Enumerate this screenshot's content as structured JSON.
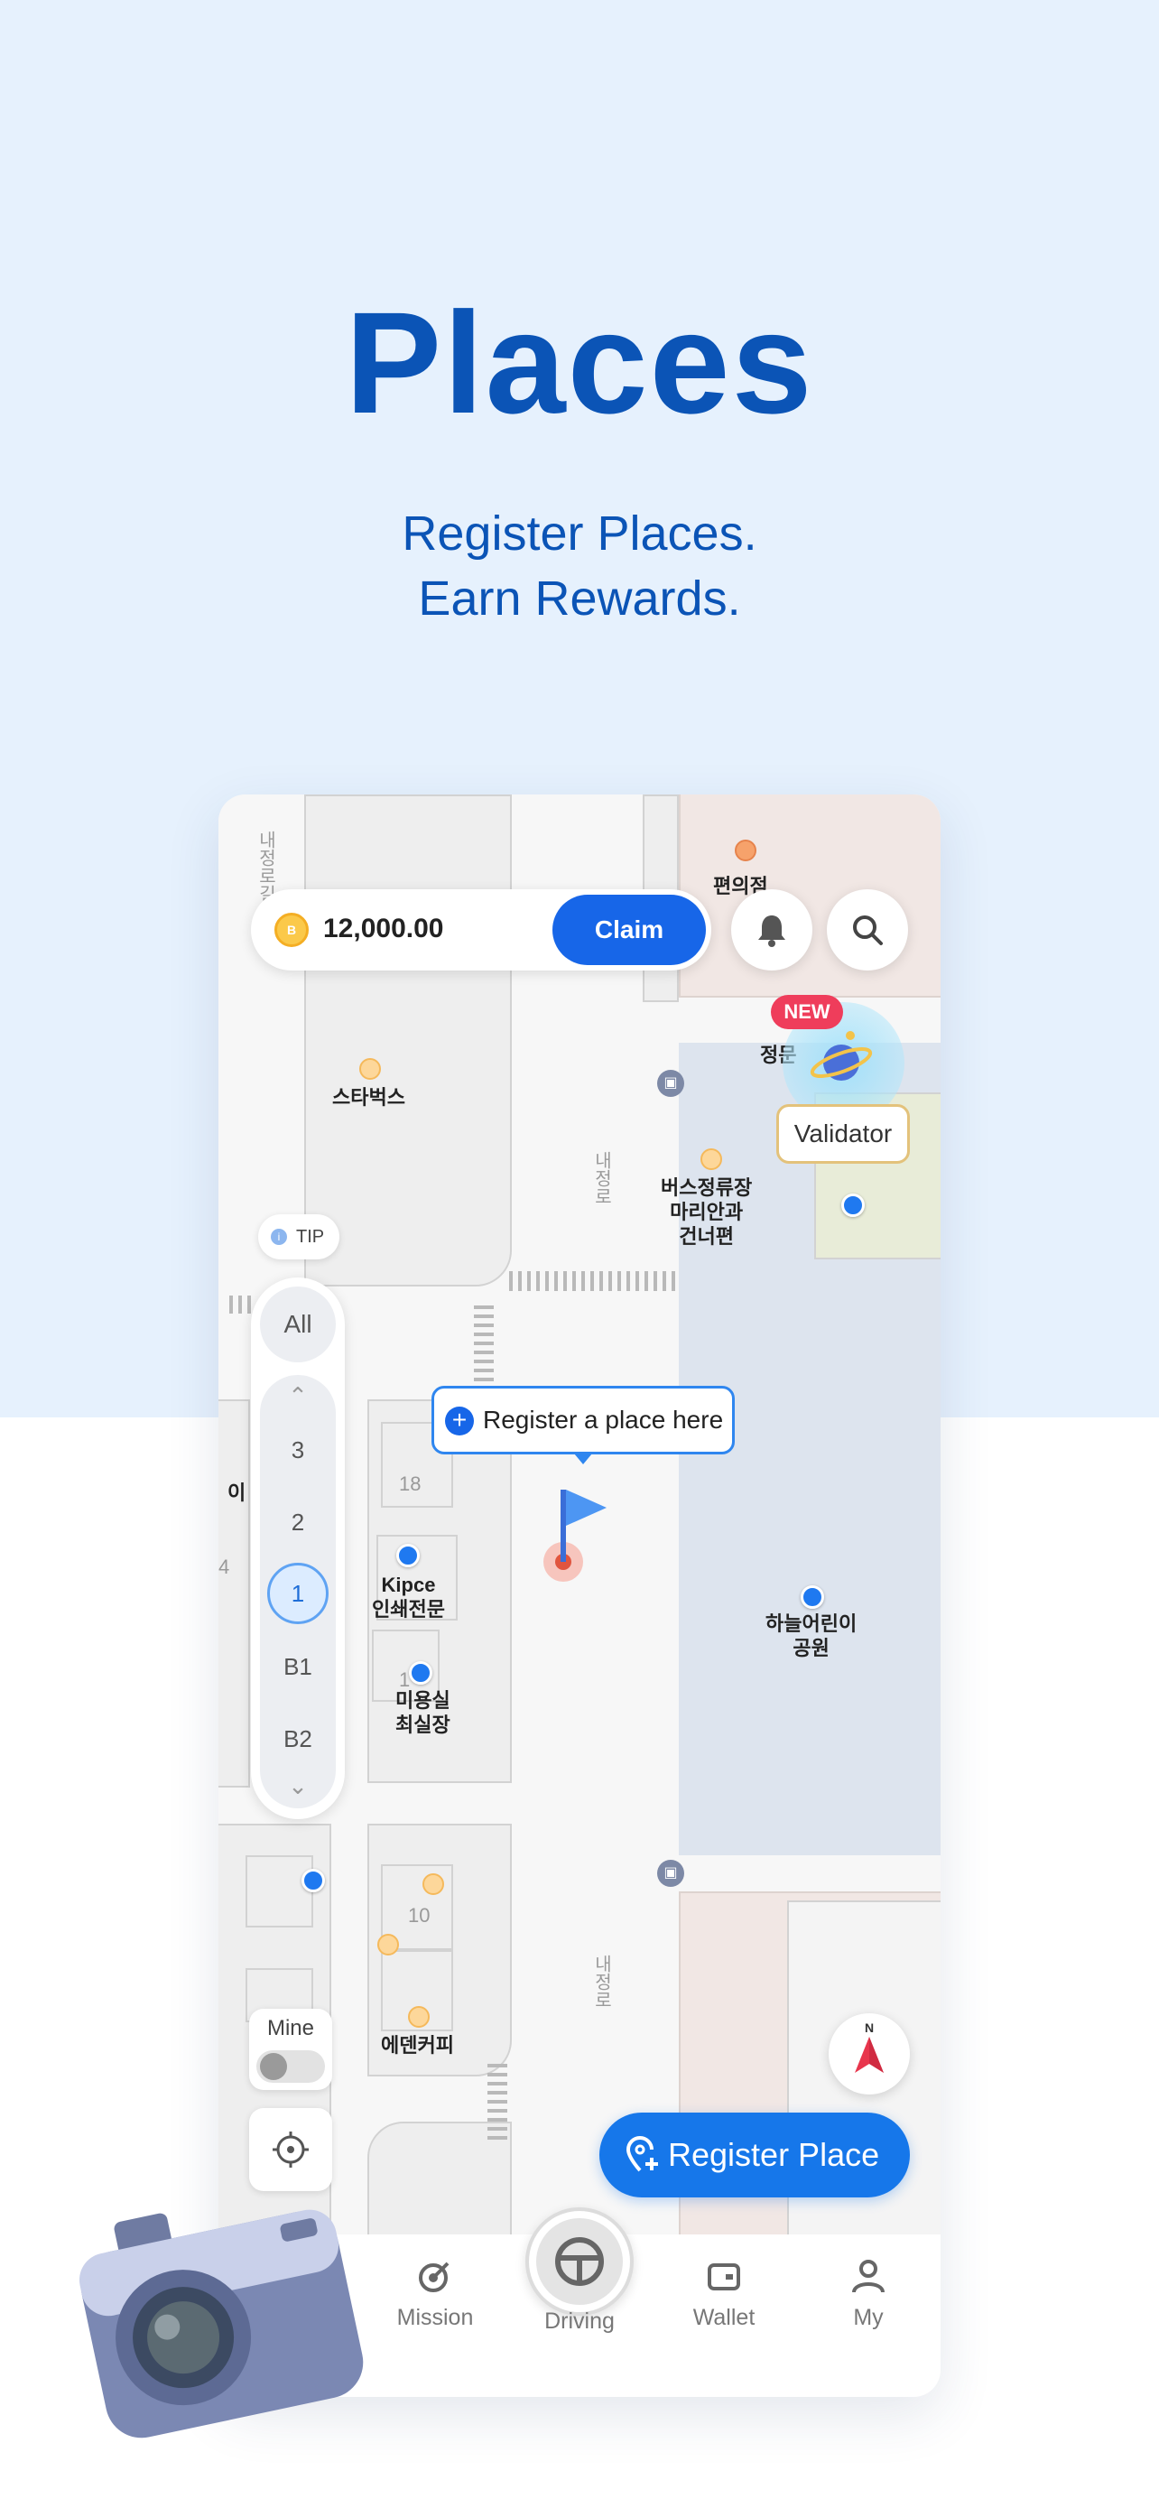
{
  "hero": {
    "title": "Places",
    "subtitle_line1": "Register Places.",
    "subtitle_line2": "Earn Rewards."
  },
  "coins": {
    "icon_letter": "B",
    "value": "12,000.00",
    "claim_label": "Claim"
  },
  "tip": {
    "label": "TIP"
  },
  "floors": {
    "all_label": "All",
    "items": [
      "3",
      "2",
      "1",
      "B1",
      "B2"
    ],
    "selected": "1"
  },
  "map": {
    "places": {
      "convenience": "편의점",
      "starbucks": "스타벅스",
      "bus_stop_line1": "버스정류장",
      "bus_stop_line2": "마리안과",
      "bus_stop_line3": "건너편",
      "gate": "정문",
      "kipce_line1": "Kipce",
      "kipce_line2": "인쇄전문",
      "salon_line1": "미용실",
      "salon_line2": "최실장",
      "park_line1": "하늘어린이",
      "park_line2": "공원",
      "cafe": "에덴커피",
      "partial": "이"
    },
    "roads": {
      "road1": "내정로",
      "road2": "내정로",
      "road3": "내정로",
      "road_left": "내정로길"
    },
    "numbers": {
      "n18": "18",
      "n10": "10",
      "n4": "4",
      "n1": "1"
    }
  },
  "validator": {
    "new_badge": "NEW",
    "label": "Validator"
  },
  "register_tip": {
    "label": "Register a place here"
  },
  "mine": {
    "label": "Mine",
    "enabled": false
  },
  "register_button": {
    "label": "Register Place"
  },
  "compass": {
    "north": "N"
  },
  "tabs": [
    {
      "label": "Mission",
      "icon": "mission-icon"
    },
    {
      "label": "Driving",
      "icon": "steering-wheel-icon"
    },
    {
      "label": "Wallet",
      "icon": "wallet-icon"
    },
    {
      "label": "My",
      "icon": "person-icon"
    }
  ],
  "colors": {
    "hero_bg": "#e6f1fd",
    "brand_blue": "#0b54b6",
    "accent": "#1677ea",
    "new_badge": "#ef3d5b"
  }
}
